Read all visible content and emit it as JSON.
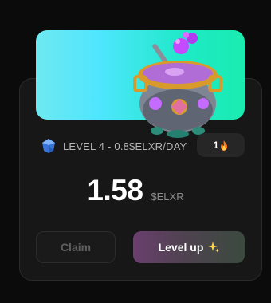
{
  "banner": {
    "image": "cauldron-icon",
    "gradient": [
      "#6fe8f0",
      "#19ecb0"
    ]
  },
  "info": {
    "icon": "gem-icon",
    "level_text": "LEVEL 4 - 0.8$ELXR/DAY"
  },
  "badge": {
    "count": "1",
    "icon": "fire-icon"
  },
  "balance": {
    "amount": "1.58",
    "unit": "$ELXR"
  },
  "buttons": {
    "claim_label": "Claim",
    "level_up_label": "Level up",
    "level_up_icon": "sparkle-icon"
  }
}
